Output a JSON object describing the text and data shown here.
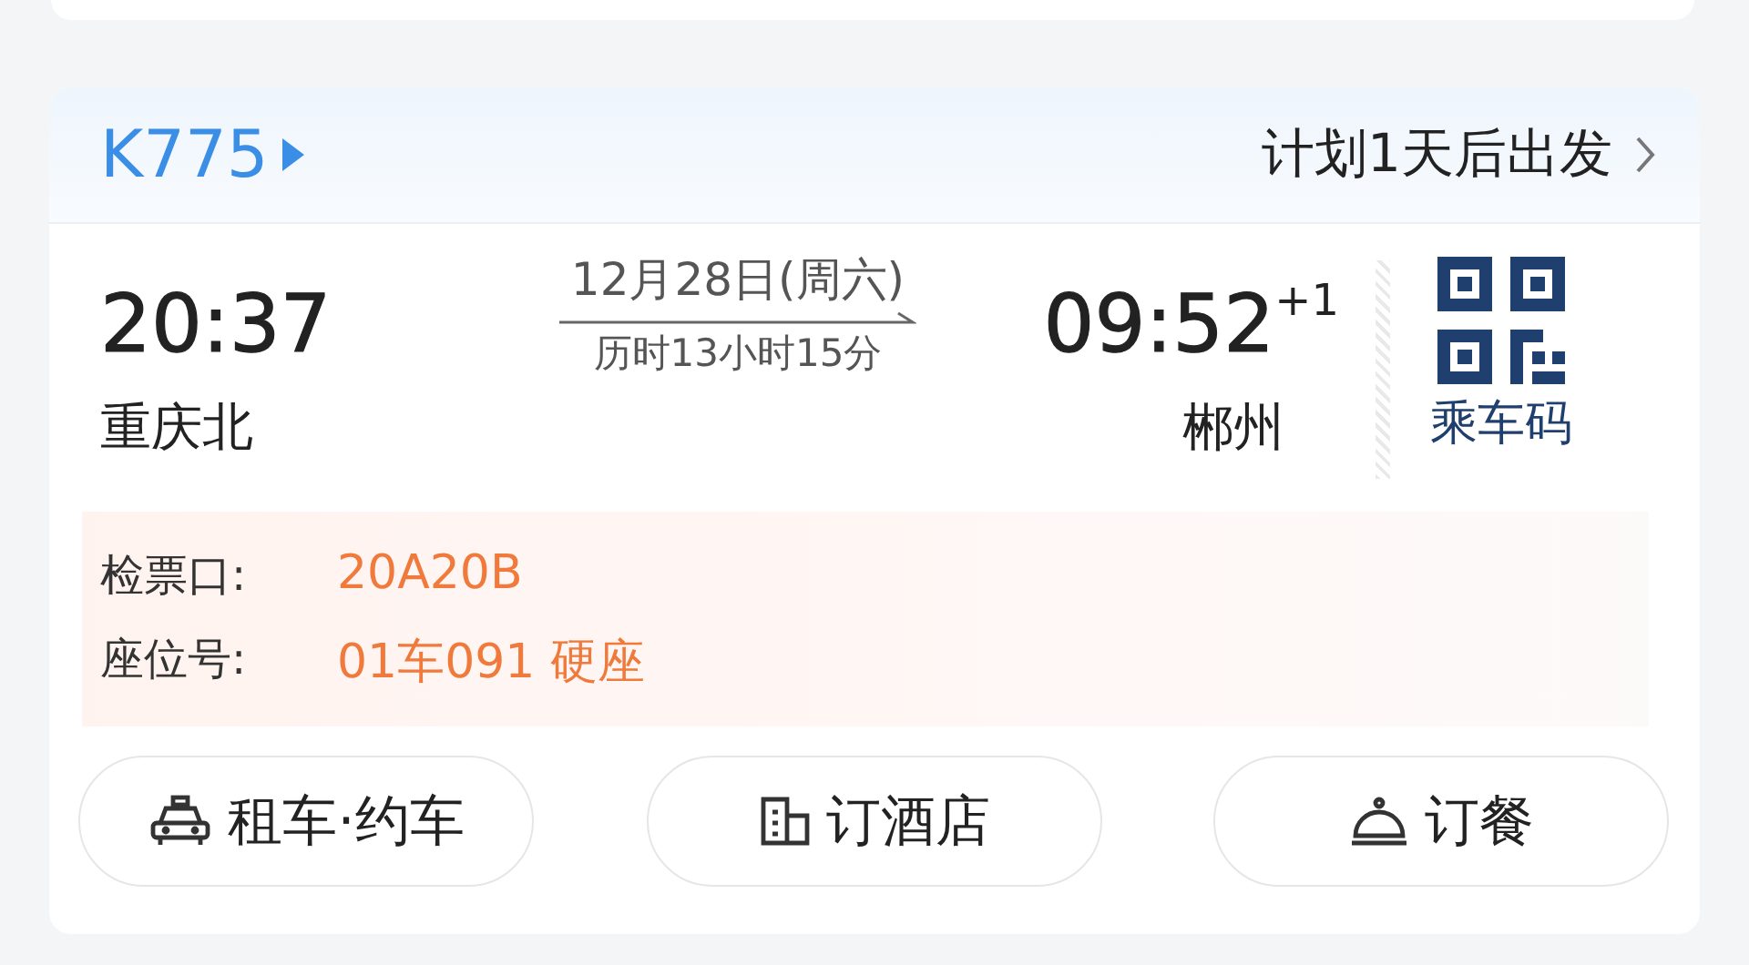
{
  "train": {
    "number": "K775",
    "status": "计划1天后出发"
  },
  "departure": {
    "time": "20:37",
    "station": "重庆北"
  },
  "journey": {
    "date": "12月28日(周六)",
    "duration": "历时13小时15分"
  },
  "arrival": {
    "time": "09:52",
    "day_offset": "+1",
    "station": "郴州"
  },
  "boarding_code": {
    "label": "乘车码"
  },
  "details": [
    {
      "label": "检票口:",
      "value": "20A20B"
    },
    {
      "label": "座位号:",
      "value": "01车091 硬座"
    }
  ],
  "actions": [
    {
      "kind": "taxi",
      "label": "租车·约车"
    },
    {
      "kind": "hotel",
      "label": "订酒店"
    },
    {
      "kind": "meal",
      "label": "订餐"
    }
  ]
}
